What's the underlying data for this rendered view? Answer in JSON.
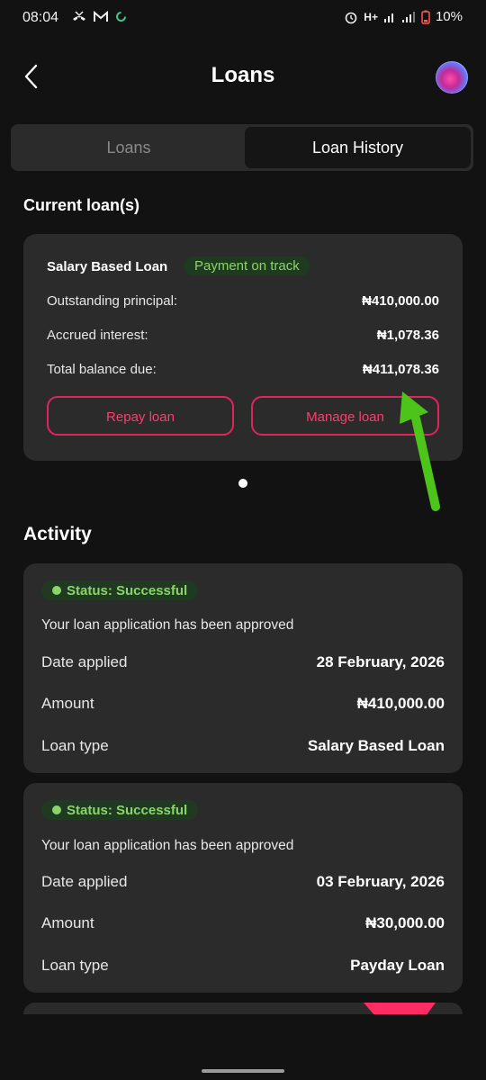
{
  "status_bar": {
    "time": "08:04",
    "network": "H+",
    "battery": "10%",
    "icons": [
      "missed-call-icon",
      "gmail-icon",
      "sync-icon",
      "alarm-icon",
      "wifi-signal-icon",
      "cell-signal-icon",
      "battery-icon"
    ]
  },
  "header": {
    "title": "Loans"
  },
  "tabs": [
    {
      "label": "Loans",
      "selected": false
    },
    {
      "label": "Loan History",
      "selected": true
    }
  ],
  "current_loans": {
    "title": "Current loan(s)",
    "loan": {
      "name": "Salary Based Loan",
      "badge": "Payment on track",
      "rows": [
        {
          "label": "Outstanding principal:",
          "value": "₦410,000.00"
        },
        {
          "label": "Accrued interest:",
          "value": "₦1,078.36"
        },
        {
          "label": "Total balance due:",
          "value": "₦411,078.36"
        }
      ],
      "repay_label": "Repay loan",
      "manage_label": "Manage loan"
    }
  },
  "activity": {
    "title": "Activity",
    "items": [
      {
        "status": "Status: Successful",
        "message": "Your loan application has been approved",
        "rows": [
          {
            "label": "Date applied",
            "value": "28 February, 2026"
          },
          {
            "label": "Amount",
            "value": "₦410,000.00"
          },
          {
            "label": "Loan type",
            "value": "Salary Based Loan"
          }
        ]
      },
      {
        "status": "Status: Successful",
        "message": "Your loan application has been approved",
        "rows": [
          {
            "label": "Date applied",
            "value": "03 February, 2026"
          },
          {
            "label": "Amount",
            "value": "₦30,000.00"
          },
          {
            "label": "Loan type",
            "value": "Payday Loan"
          }
        ]
      }
    ]
  },
  "colors": {
    "background": "#121212",
    "card": "#2b2b2b",
    "accent": "#e0245e",
    "success": "#8bd46a",
    "annotation_arrow": "#4cc419"
  }
}
